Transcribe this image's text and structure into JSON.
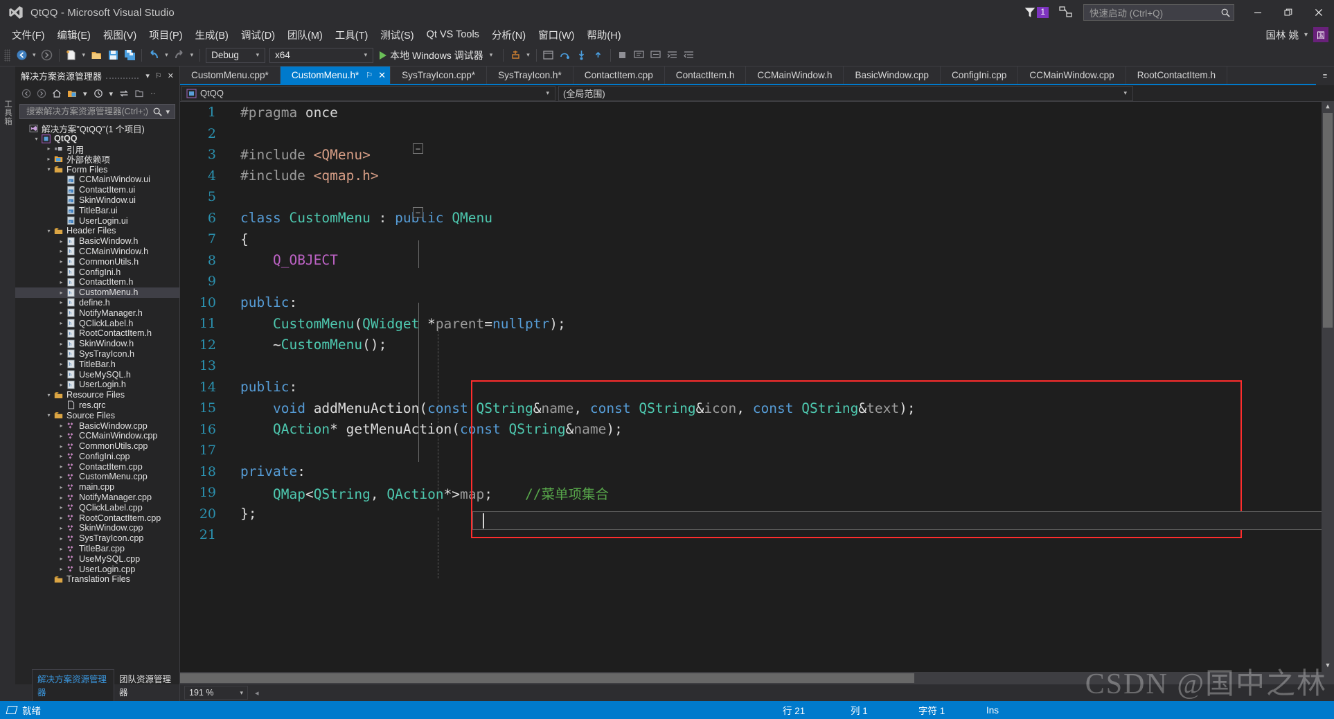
{
  "window": {
    "title": "QtQQ - Microsoft Visual Studio",
    "minimize": "—",
    "restore": "❐",
    "close": "✕"
  },
  "notifications": {
    "count": "1"
  },
  "quick_launch": {
    "placeholder": "快速启动 (Ctrl+Q)",
    "value": ""
  },
  "account": {
    "name": "国林 姚",
    "caret": "▾",
    "avatar_initial": "国"
  },
  "menu": {
    "items": [
      "文件(F)",
      "编辑(E)",
      "视图(V)",
      "项目(P)",
      "生成(B)",
      "调试(D)",
      "团队(M)",
      "工具(T)",
      "测试(S)",
      "Qt VS Tools",
      "分析(N)",
      "窗口(W)",
      "帮助(H)"
    ]
  },
  "toolbar": {
    "nav_back": "navigate-back",
    "nav_forward": "navigate-forward",
    "new_item": "new-item",
    "open_file": "open-file",
    "save": "save",
    "save_all": "save-all",
    "undo": "undo",
    "redo": "redo",
    "config": {
      "value": "Debug",
      "caret": "▾"
    },
    "platform": {
      "value": "x64",
      "caret": "▾"
    },
    "run_label": "本地 Windows 调试器",
    "run_caret": "▾"
  },
  "solution_explorer": {
    "title": "解决方案资源管理器",
    "caret": "▾",
    "pin": "⚐",
    "close": "✕",
    "search_placeholder": "搜索解决方案资源管理器(Ctrl+;)",
    "search_value": "",
    "toolbar_icons": [
      "back-icon",
      "forward-icon",
      "home-icon",
      "sync-with-active-document-icon",
      "pending-changes-icon",
      "refresh-icon",
      "show-all-files-icon",
      "properties-icon"
    ],
    "tree": [
      {
        "label": "解决方案\"QtQQ\"(1 个项目)",
        "indent": 1,
        "arrow": "",
        "icon": "solution-icon",
        "bold": false,
        "selected": false
      },
      {
        "label": "QtQQ",
        "indent": 2,
        "arrow": "▾",
        "icon": "project-icon",
        "bold": true,
        "selected": false
      },
      {
        "label": "引用",
        "indent": 3,
        "arrow": "▸",
        "icon": "references-icon",
        "bold": false,
        "selected": false
      },
      {
        "label": "外部依赖项",
        "indent": 3,
        "arrow": "▸",
        "icon": "folder-icon",
        "bold": false,
        "selected": false
      },
      {
        "label": "Form Files",
        "indent": 3,
        "arrow": "▾",
        "icon": "filter-folder-icon",
        "bold": false,
        "selected": false
      },
      {
        "label": "CCMainWindow.ui",
        "indent": 4,
        "arrow": "",
        "icon": "ui-file-icon",
        "bold": false,
        "selected": false
      },
      {
        "label": "ContactItem.ui",
        "indent": 4,
        "arrow": "",
        "icon": "ui-file-icon",
        "bold": false,
        "selected": false
      },
      {
        "label": "SkinWindow.ui",
        "indent": 4,
        "arrow": "",
        "icon": "ui-file-icon",
        "bold": false,
        "selected": false
      },
      {
        "label": "TitleBar.ui",
        "indent": 4,
        "arrow": "",
        "icon": "ui-file-icon",
        "bold": false,
        "selected": false
      },
      {
        "label": "UserLogin.ui",
        "indent": 4,
        "arrow": "",
        "icon": "ui-file-icon",
        "bold": false,
        "selected": false
      },
      {
        "label": "Header Files",
        "indent": 3,
        "arrow": "▾",
        "icon": "filter-folder-icon",
        "bold": false,
        "selected": false
      },
      {
        "label": "BasicWindow.h",
        "indent": 4,
        "arrow": "▸",
        "icon": "h-file-icon",
        "bold": false,
        "selected": false
      },
      {
        "label": "CCMainWindow.h",
        "indent": 4,
        "arrow": "▸",
        "icon": "h-file-icon",
        "bold": false,
        "selected": false
      },
      {
        "label": "CommonUtils.h",
        "indent": 4,
        "arrow": "▸",
        "icon": "h-file-icon",
        "bold": false,
        "selected": false
      },
      {
        "label": "ConfigIni.h",
        "indent": 4,
        "arrow": "▸",
        "icon": "h-file-icon",
        "bold": false,
        "selected": false
      },
      {
        "label": "ContactItem.h",
        "indent": 4,
        "arrow": "▸",
        "icon": "h-file-icon",
        "bold": false,
        "selected": false
      },
      {
        "label": "CustomMenu.h",
        "indent": 4,
        "arrow": "▸",
        "icon": "h-file-icon",
        "bold": false,
        "selected": true
      },
      {
        "label": "define.h",
        "indent": 4,
        "arrow": "▸",
        "icon": "h-file-icon",
        "bold": false,
        "selected": false
      },
      {
        "label": "NotifyManager.h",
        "indent": 4,
        "arrow": "▸",
        "icon": "h-file-icon",
        "bold": false,
        "selected": false
      },
      {
        "label": "QClickLabel.h",
        "indent": 4,
        "arrow": "▸",
        "icon": "h-file-icon",
        "bold": false,
        "selected": false
      },
      {
        "label": "RootContactItem.h",
        "indent": 4,
        "arrow": "▸",
        "icon": "h-file-icon",
        "bold": false,
        "selected": false
      },
      {
        "label": "SkinWindow.h",
        "indent": 4,
        "arrow": "▸",
        "icon": "h-file-icon",
        "bold": false,
        "selected": false
      },
      {
        "label": "SysTrayIcon.h",
        "indent": 4,
        "arrow": "▸",
        "icon": "h-file-icon",
        "bold": false,
        "selected": false
      },
      {
        "label": "TitleBar.h",
        "indent": 4,
        "arrow": "▸",
        "icon": "h-file-icon",
        "bold": false,
        "selected": false
      },
      {
        "label": "UseMySQL.h",
        "indent": 4,
        "arrow": "▸",
        "icon": "h-file-icon",
        "bold": false,
        "selected": false
      },
      {
        "label": "UserLogin.h",
        "indent": 4,
        "arrow": "▸",
        "icon": "h-file-icon",
        "bold": false,
        "selected": false
      },
      {
        "label": "Resource Files",
        "indent": 3,
        "arrow": "▾",
        "icon": "filter-folder-icon",
        "bold": false,
        "selected": false
      },
      {
        "label": "res.qrc",
        "indent": 4,
        "arrow": "",
        "icon": "generic-file-icon",
        "bold": false,
        "selected": false
      },
      {
        "label": "Source Files",
        "indent": 3,
        "arrow": "▾",
        "icon": "filter-folder-icon",
        "bold": false,
        "selected": false
      },
      {
        "label": "BasicWindow.cpp",
        "indent": 4,
        "arrow": "▸",
        "icon": "cpp-file-icon",
        "bold": false,
        "selected": false
      },
      {
        "label": "CCMainWindow.cpp",
        "indent": 4,
        "arrow": "▸",
        "icon": "cpp-file-icon",
        "bold": false,
        "selected": false
      },
      {
        "label": "CommonUtils.cpp",
        "indent": 4,
        "arrow": "▸",
        "icon": "cpp-file-icon",
        "bold": false,
        "selected": false
      },
      {
        "label": "ConfigIni.cpp",
        "indent": 4,
        "arrow": "▸",
        "icon": "cpp-file-icon",
        "bold": false,
        "selected": false
      },
      {
        "label": "ContactItem.cpp",
        "indent": 4,
        "arrow": "▸",
        "icon": "cpp-file-icon",
        "bold": false,
        "selected": false
      },
      {
        "label": "CustomMenu.cpp",
        "indent": 4,
        "arrow": "▸",
        "icon": "cpp-file-icon",
        "bold": false,
        "selected": false
      },
      {
        "label": "main.cpp",
        "indent": 4,
        "arrow": "▸",
        "icon": "cpp-file-icon",
        "bold": false,
        "selected": false
      },
      {
        "label": "NotifyManager.cpp",
        "indent": 4,
        "arrow": "▸",
        "icon": "cpp-file-icon",
        "bold": false,
        "selected": false
      },
      {
        "label": "QClickLabel.cpp",
        "indent": 4,
        "arrow": "▸",
        "icon": "cpp-file-icon",
        "bold": false,
        "selected": false
      },
      {
        "label": "RootContactItem.cpp",
        "indent": 4,
        "arrow": "▸",
        "icon": "cpp-file-icon",
        "bold": false,
        "selected": false
      },
      {
        "label": "SkinWindow.cpp",
        "indent": 4,
        "arrow": "▸",
        "icon": "cpp-file-icon",
        "bold": false,
        "selected": false
      },
      {
        "label": "SysTrayIcon.cpp",
        "indent": 4,
        "arrow": "▸",
        "icon": "cpp-file-icon",
        "bold": false,
        "selected": false
      },
      {
        "label": "TitleBar.cpp",
        "indent": 4,
        "arrow": "▸",
        "icon": "cpp-file-icon",
        "bold": false,
        "selected": false
      },
      {
        "label": "UseMySQL.cpp",
        "indent": 4,
        "arrow": "▸",
        "icon": "cpp-file-icon",
        "bold": false,
        "selected": false
      },
      {
        "label": "UserLogin.cpp",
        "indent": 4,
        "arrow": "▸",
        "icon": "cpp-file-icon",
        "bold": false,
        "selected": false
      },
      {
        "label": "Translation Files",
        "indent": 3,
        "arrow": "",
        "icon": "filter-folder-icon",
        "bold": false,
        "selected": false
      }
    ],
    "bottom_tabs": [
      {
        "label": "解决方案资源管理器",
        "active": true
      },
      {
        "label": "团队资源管理器",
        "active": false
      }
    ]
  },
  "left_strip": {
    "label": "工具箱"
  },
  "editor_tabs": {
    "tabs": [
      {
        "label": "CustomMenu.cpp*",
        "active": false
      },
      {
        "label": "CustomMenu.h*",
        "active": true,
        "pin": "⚐",
        "close": "✕"
      },
      {
        "label": "SysTrayIcon.cpp*",
        "active": false
      },
      {
        "label": "SysTrayIcon.h*",
        "active": false
      },
      {
        "label": "ContactItem.cpp",
        "active": false
      },
      {
        "label": "ContactItem.h",
        "active": false
      },
      {
        "label": "CCMainWindow.h",
        "active": false
      },
      {
        "label": "BasicWindow.cpp",
        "active": false
      },
      {
        "label": "ConfigIni.cpp",
        "active": false
      },
      {
        "label": "CCMainWindow.cpp",
        "active": false
      },
      {
        "label": "RootContactItem.h",
        "active": false
      }
    ],
    "overflow": "≡"
  },
  "nav_bar": {
    "project": "QtQQ",
    "project_caret": "▾",
    "scope": "(全局范围)",
    "scope_caret": "▾"
  },
  "code": {
    "lines": [
      {
        "n": "1",
        "changed": false,
        "text": "#pragma once"
      },
      {
        "n": "2",
        "changed": false,
        "text": ""
      },
      {
        "n": "3",
        "changed": true,
        "text": "#include <QMenu>"
      },
      {
        "n": "4",
        "changed": true,
        "text": "#include <qmap.h>"
      },
      {
        "n": "5",
        "changed": false,
        "text": ""
      },
      {
        "n": "6",
        "changed": false,
        "text": "class CustomMenu : public QMenu"
      },
      {
        "n": "7",
        "changed": false,
        "text": "{"
      },
      {
        "n": "8",
        "changed": false,
        "text": "    Q_OBJECT"
      },
      {
        "n": "9",
        "changed": false,
        "text": ""
      },
      {
        "n": "10",
        "changed": false,
        "text": "public:"
      },
      {
        "n": "11",
        "changed": true,
        "text": "    CustomMenu(QWidget *parent=nullptr);"
      },
      {
        "n": "12",
        "changed": true,
        "text": "    ~CustomMenu();"
      },
      {
        "n": "13",
        "changed": true,
        "text": ""
      },
      {
        "n": "14",
        "changed": true,
        "text": "public:"
      },
      {
        "n": "15",
        "changed": true,
        "text": "    void addMenuAction(const QString&name, const QString&icon, const QString&text);"
      },
      {
        "n": "16",
        "changed": true,
        "text": "    QAction* getMenuAction(const QString&name);"
      },
      {
        "n": "17",
        "changed": true,
        "text": ""
      },
      {
        "n": "18",
        "changed": true,
        "text": "private:"
      },
      {
        "n": "19",
        "changed": true,
        "text": "    QMap<QString, QAction*>map;    //菜单项集合"
      },
      {
        "n": "20",
        "changed": false,
        "text": "};"
      },
      {
        "n": "21",
        "changed": false,
        "text": ""
      }
    ],
    "comment_line_19": "//菜单项集合"
  },
  "zoom": {
    "value": "191 %",
    "caret": "▾"
  },
  "status": {
    "ready": "就绪",
    "line_label": "行 21",
    "col_label": "列 1",
    "char_label": "字符 1",
    "insert_mode": "Ins"
  },
  "watermark": {
    "text": "CSDN @国中之林"
  },
  "colors": {
    "accent": "#007acc",
    "titlebar_bg": "#2d2d30",
    "editor_bg": "#1e1e1e",
    "panel_bg": "#252526",
    "purple": "#68217a",
    "highlight_red": "#ff2d2d",
    "change_yellow": "#e8e88a"
  }
}
